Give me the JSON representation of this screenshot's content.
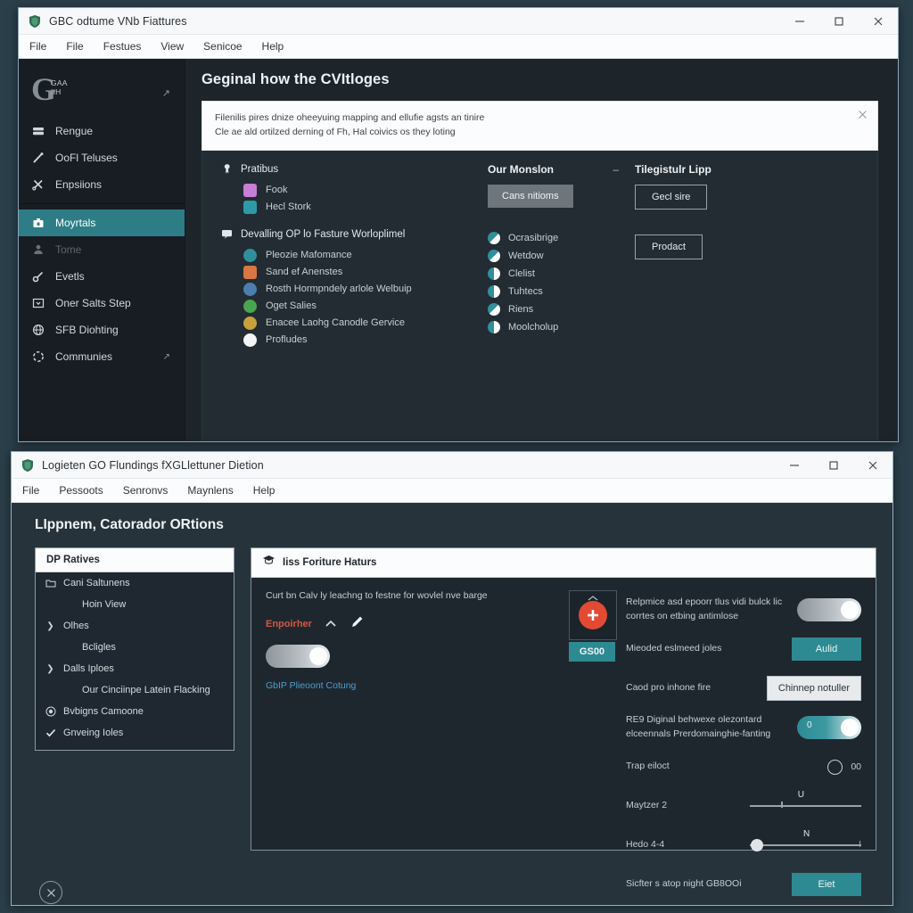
{
  "window_top": {
    "title": "GBC odtume VNb Fiattures",
    "title_icon": "app-shield-icon",
    "menu": [
      "File",
      "File",
      "Festues",
      "View",
      "Senicoe",
      "Help"
    ],
    "controls": {
      "minimize": "minimize-icon",
      "maximize": "maximize-icon",
      "close": "close-icon"
    },
    "sidebar": {
      "brand_glyph": "G",
      "brand_line1": "GAA",
      "brand_line2": "IIH",
      "brand_arrow": "↗",
      "items": [
        {
          "label": "Rengue",
          "icon": "server-icon",
          "state": "normal"
        },
        {
          "label": "OoFl Teluses",
          "icon": "wand-icon",
          "state": "normal"
        },
        {
          "label": "Enpsiions",
          "icon": "scissors-icon",
          "state": "normal"
        },
        {
          "label": "Moyrtals",
          "icon": "briefcase-icon",
          "state": "active"
        },
        {
          "label": "Tome",
          "icon": "person-icon",
          "state": "dim"
        },
        {
          "label": "Evetls",
          "icon": "key-icon",
          "state": "normal"
        },
        {
          "label": "Oner Salts Step",
          "icon": "inbox-icon",
          "state": "normal"
        },
        {
          "label": "SFB Diohting",
          "icon": "globe-icon",
          "state": "normal"
        },
        {
          "label": "Communies",
          "icon": "spinner-icon",
          "state": "normal",
          "arrow": "↗"
        }
      ]
    },
    "content": {
      "page_title": "Geginal how the CVItloges",
      "notice": {
        "line1": "Filenilis pires dnize oheeyuing mapping and ellufie agsts an tinire",
        "line2": "Cle ae ald ortilzed derning of Fh, Hal coivics os they loting",
        "close": "close-icon"
      },
      "group1": {
        "title": "Pratibus",
        "icon": "pin-icon",
        "items": [
          {
            "label": "Fook",
            "color": "#c77fd6"
          },
          {
            "label": "Hecl Stork",
            "color": "#2e9aa8"
          }
        ]
      },
      "group2": {
        "title": "Devalling OP lo Fasture Worloplimel",
        "icon": "chat-icon",
        "items": [
          {
            "label": "Pleozie Mafomance",
            "color": "#2f8f9c"
          },
          {
            "label": "Sand ef Anenstes",
            "color": "#d97642"
          },
          {
            "label": "Rosth Hormpndely arlole Welbuip",
            "color": "#4b7fae"
          },
          {
            "label": "Oget Salies",
            "color": "#4aa64e"
          },
          {
            "label": "Enacee Laohg Canodle Gervice",
            "color": "#c9a13c"
          },
          {
            "label": "Profludes",
            "color": "#f2f4f6"
          }
        ]
      },
      "col_mission": {
        "heading": "Our Monslon",
        "minus": "–",
        "button": "Cans nitioms",
        "items": [
          {
            "label": "Ocrasibrige"
          },
          {
            "label": "Wetdow"
          },
          {
            "label": "Clelist"
          },
          {
            "label": "Tuhtecs"
          },
          {
            "label": "Riens"
          },
          {
            "label": "Moolcholup"
          }
        ]
      },
      "col_lipp": {
        "heading": "Tilegistulr Lipp",
        "button1": "Gecl sire",
        "button2": "Prodact"
      }
    }
  },
  "window_bottom": {
    "title": "Logieten GO Flundings fXGLlettuner Dietion",
    "title_icon": "app-shield-icon",
    "menu": [
      "File",
      "Pessoots",
      "Senronvs",
      "Maynlens",
      "Help"
    ],
    "controls": {
      "minimize": "minimize-icon",
      "maximize": "maximize-icon",
      "close": "close-icon"
    },
    "heading": "LIppnem, Catorador ORtions",
    "tree": {
      "header": "DP Ratives",
      "items": [
        {
          "label": "Cani Saltunens",
          "icon": "folder-icon",
          "indent": 0
        },
        {
          "label": "Hoin View",
          "icon": "",
          "indent": 1
        },
        {
          "label": "Olhes",
          "icon": "chevron-right-icon",
          "indent": 0
        },
        {
          "label": "Bcligles",
          "icon": "",
          "indent": 1
        },
        {
          "label": "Dalls Iploes",
          "icon": "chevron-right-icon",
          "indent": 0
        },
        {
          "label": "Our Cinciinpe Latein Flacking",
          "icon": "",
          "indent": 1
        },
        {
          "label": "Bvbigns Camoone",
          "icon": "radio-on-icon",
          "indent": 0
        },
        {
          "label": "Gnveing Ioles",
          "icon": "check-icon",
          "indent": 0
        }
      ]
    },
    "right_panel": {
      "header": "Iiss Foriture Haturs",
      "header_icon": "graduation-cap-icon",
      "hint": "Curt bn Calv ly leachng to festne for wovlel nve barge",
      "red_label": "Enpoirher",
      "caret_icon": "caret-up-icon",
      "pencil_icon": "pencil-icon",
      "toggle_left": {
        "state": "on",
        "color": "#b9bfc4"
      },
      "link": "GbIP Plieoont Cotung",
      "gbox": {
        "label": "GS00",
        "icon": "plus-circle-icon",
        "icon_color": "#e34a33",
        "caret": "caret-up-icon"
      },
      "rows": [
        {
          "label": "Relpmice asd epoorr tlus vidi bulck lic corrtes on etbing antimlose",
          "control": "toggle",
          "state": "on",
          "value": "",
          "color": "#b9bfc4"
        },
        {
          "label": "Mieoded eslmeed joles",
          "control": "button-teal",
          "value": "Aulid"
        },
        {
          "label": "Caod pro inhone fire",
          "control": "button-light",
          "value": "Chinnep notuller"
        },
        {
          "label": "RE9 Diginal behwexe olezontard elceennals Prerdomainghie-fanting",
          "control": "toggle",
          "state": "on",
          "value": "0",
          "color": "#2e8a92"
        },
        {
          "label": "Trap eiloct",
          "control": "radio",
          "value": "00"
        },
        {
          "label": "Maytzer 2",
          "control": "slider",
          "value": "U",
          "pos": 42
        },
        {
          "label": "Hedo 4-4",
          "control": "slider",
          "value": "N",
          "pos": 3
        },
        {
          "label": "Sicfter s atop night GB8OOi",
          "control": "button-teal",
          "value": "Eiet"
        }
      ]
    },
    "close_circle": "close-circle-icon"
  }
}
